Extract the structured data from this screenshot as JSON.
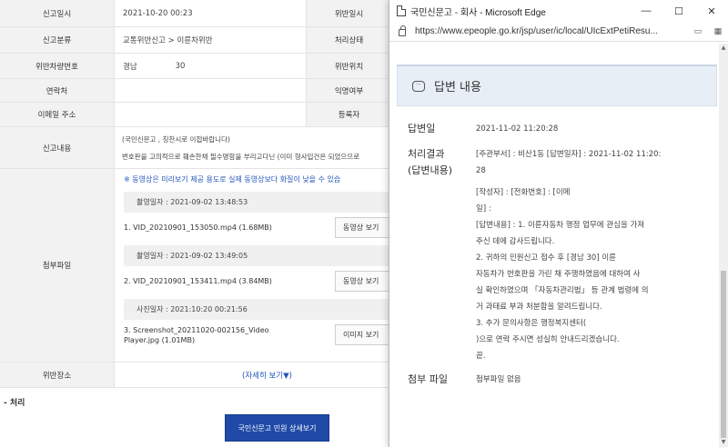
{
  "report": {
    "rows": [
      {
        "label": "신고일시",
        "value": "2021-10-20 00:23",
        "label2": "위반일시"
      },
      {
        "label": "신고분류",
        "value": "교통위반신고 > 이륜차위반",
        "label2": "처리상태"
      },
      {
        "label": "위반차량번호",
        "value": "경남",
        "value_suffix": "30",
        "label2": "위반위치"
      },
      {
        "label": "연락처",
        "value": "",
        "label2": "익명여부"
      },
      {
        "label": "이메일 주소",
        "value": "",
        "label2": "등록자"
      }
    ],
    "content": {
      "label": "신고내용",
      "line1": "(국민신문고 , 칭찬시로 이첩바랍니다)",
      "line2": "번호판을 고의적으로 훼손한채 필수명함을 부리고다닌 (이미 형사입건은 되었으므로"
    },
    "attachments": {
      "label": "첨부파일",
      "note": "※ 동영상은 미리보기 제공 용도로 실제 동영상보다 화질이 낮을 수 있습",
      "items": [
        {
          "date": "촬영일자 : 2021-09-02 13:48:53",
          "file": "1. VID_20210901_153050.mp4 (1.68MB)",
          "button": "동영상 보기"
        },
        {
          "date": "촬영일자 : 2021-09-02 13:49:05",
          "file": "2. VID_20210901_153411.mp4 (3.84MB)",
          "button": "동영상 보기"
        },
        {
          "date": "사진일자 : 2021:10:20 00:21:56",
          "file": "3. Screenshot_20211020-002156_Video Player.jpg (1.01MB)",
          "button": "이미지 보기"
        }
      ]
    },
    "location": {
      "label": "위반장소",
      "detail": "(자세히 보기▼)"
    },
    "section_title": "- 처리",
    "detail_button": "국민신문고 민원 상세보기"
  },
  "popup": {
    "window_title": "국민신문고 - 회사 - Microsoft Edge",
    "controls": {
      "minimize": "—",
      "maximize": "☐",
      "close": "✕"
    },
    "url": "https://www.epeople.go.kr/jsp/user/ic/local/UIcExtPetiResu...",
    "answer": {
      "header_title": "답변 내용",
      "date_label": "답변일",
      "date_value": "2021-11-02 11:20:28",
      "result_label_1": "처리결과",
      "result_label_2": "(답변내용)",
      "lines": [
        "[주관부서] : 비산1동 [답변일자] : 2021-11-02 11:20:",
        "28",
        "[작성자] :              [전화번호] :                  [이메",
        "일] :",
        "[답변내용] : 1. 이륜자동차 행정 업무에 관심을 가져",
        "주신 데에 감사드립니다.",
        "2. 귀하의 민원신고 접수 후  [경남           30] 이륜",
        "자동차가 번호판을 가린 채 주행하였음에 대하여 사",
        "실 확인하였으며 「자동차관리법」 등 관계 법령에 의",
        "거 과태료 부과 처분함을 알려드립니다.",
        "3. 추가 문의사항은            행정복지센터(",
        "          )으로 연락 주시면 성실히 안내드리겠습니다.",
        "끝."
      ],
      "attach_label": "첨부 파일",
      "attach_value": "첨부파일 없음"
    }
  }
}
